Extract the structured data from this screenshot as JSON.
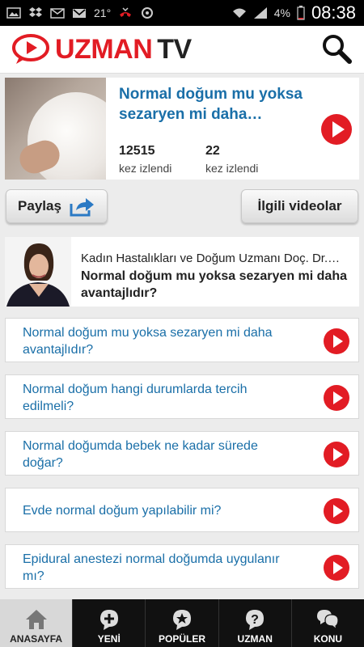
{
  "status_bar": {
    "time": "08:38",
    "battery": "4%",
    "temperature": "21°",
    "icons": [
      "gallery-icon",
      "dropbox-icon",
      "email-icon",
      "gmail-icon",
      "missed-call-icon",
      "sync-icon",
      "wifi-icon",
      "signal-icon",
      "battery-icon"
    ]
  },
  "header": {
    "logo_brand": "UZMAN",
    "logo_suffix": "TV",
    "brand_color": "#e21c24",
    "search_icon": "search-icon"
  },
  "hero": {
    "title": "Normal doğum mu yoksa sezaryen mi daha…",
    "views_count": "12515",
    "views_label": "kez izlendi",
    "second_count": "22",
    "second_label": "kez izlendi"
  },
  "actions": {
    "share_label": "Paylaş",
    "related_label": "İlgili videolar"
  },
  "expert": {
    "name": "Kadın Hastalıkları ve Doğum Uzmanı Doç. Dr.…",
    "question": "Normal doğum mu yoksa sezaryen mi daha avantajlıdır?"
  },
  "questions": [
    {
      "text": "Normal doğum mu yoksa sezaryen mi daha avantajlıdır?"
    },
    {
      "text": "Normal doğum hangi durumlarda tercih edilmeli?"
    },
    {
      "text": "Normal doğumda bebek ne kadar sürede doğar?"
    },
    {
      "text": "Evde normal doğum yapılabilir mi?"
    },
    {
      "text": "Epidural anestezi normal doğumda uygulanır mı?"
    }
  ],
  "tabs": [
    {
      "label": "ANASAYFA",
      "icon": "home-icon",
      "active": true
    },
    {
      "label": "YENİ",
      "icon": "plus-icon",
      "active": false
    },
    {
      "label": "POPÜLER",
      "icon": "star-icon",
      "active": false
    },
    {
      "label": "UZMAN",
      "icon": "question-icon",
      "active": false
    },
    {
      "label": "KONU",
      "icon": "chat-icon",
      "active": false
    }
  ],
  "colors": {
    "link_blue": "#1a6fa8",
    "play_red": "#e21c24"
  }
}
